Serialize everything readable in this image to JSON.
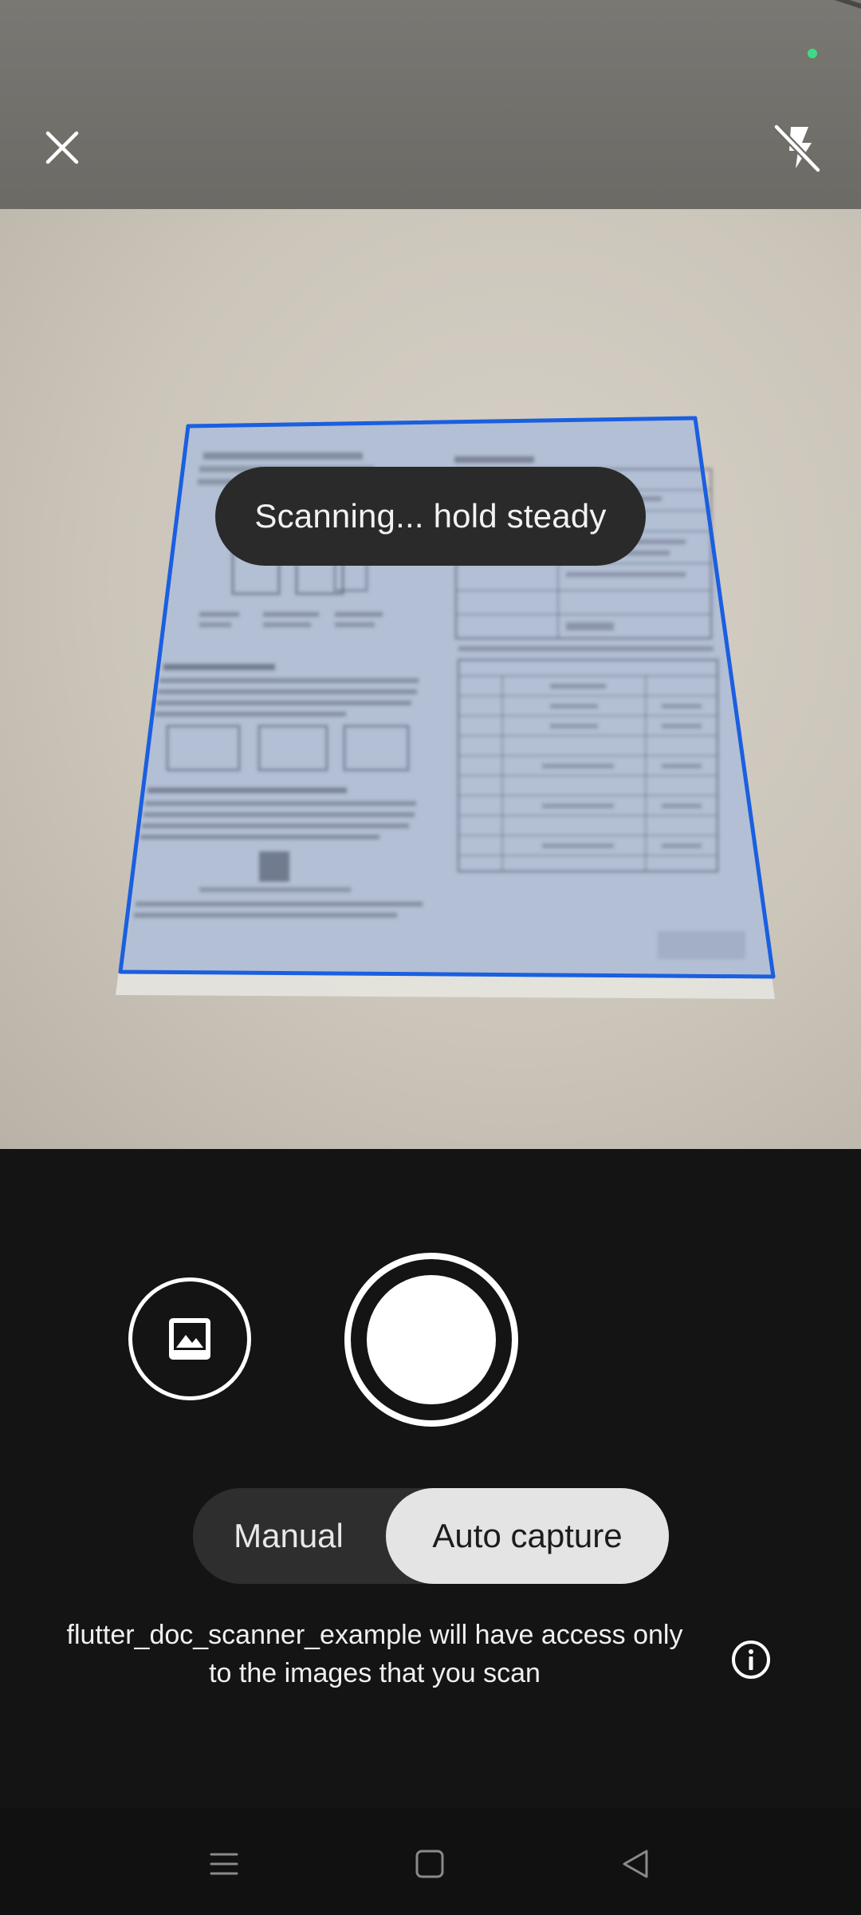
{
  "top_bar": {
    "close_icon": "close-icon",
    "flash_icon": "flash-off-icon",
    "status_dot_color": "#3ddc84"
  },
  "viewfinder": {
    "toast_text": "Scanning... hold steady",
    "detection_outline_color": "#1a5fe0"
  },
  "controls": {
    "gallery_icon": "image-icon",
    "shutter_icon": "shutter-icon",
    "mode_manual_label": "Manual",
    "mode_auto_label": "Auto capture",
    "selected_mode": "Auto capture",
    "access_note": "flutter_doc_scanner_example will have access only to the images that you scan",
    "info_icon": "info-icon"
  },
  "nav_bar": {
    "menu_icon": "menu-icon",
    "home_icon": "home-icon",
    "back_icon": "back-icon"
  }
}
